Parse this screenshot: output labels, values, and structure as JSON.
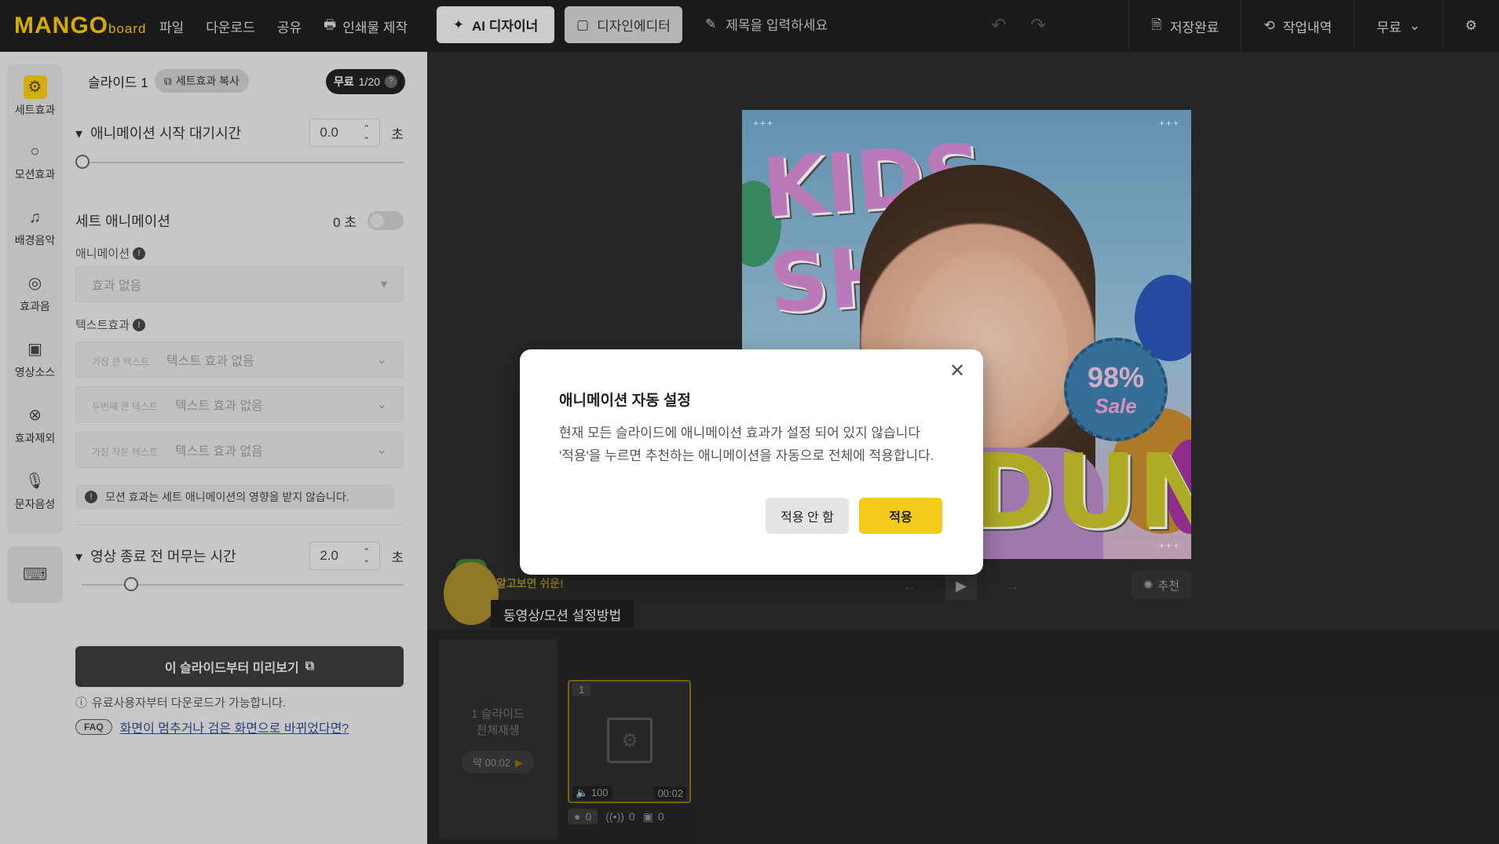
{
  "topbar": {
    "logo_main": "MANGO",
    "logo_sub": "board",
    "menu": [
      {
        "label": "파일"
      },
      {
        "label": "다운로드"
      },
      {
        "label": "공유"
      },
      {
        "label": "인쇄물 제작"
      }
    ],
    "ai_designer": "AI 디자이너",
    "design_editor": "디자인에디터",
    "title_placeholder": "제목을 입력하세요",
    "save_status": "저장완료",
    "history": "작업내역",
    "plan": "무료"
  },
  "sidebar": {
    "icons": [
      {
        "label": "세트효과",
        "icon": "set-effect-icon"
      },
      {
        "label": "모션효과",
        "icon": "motion-effect-icon"
      },
      {
        "label": "배경음악",
        "icon": "music-note-icon"
      },
      {
        "label": "효과음",
        "icon": "sound-effect-icon"
      },
      {
        "label": "영상소스",
        "icon": "video-source-icon"
      },
      {
        "label": "효과제외",
        "icon": "exclude-effect-icon"
      },
      {
        "label": "문자음성",
        "icon": "microphone-icon"
      }
    ]
  },
  "panel": {
    "slide_title": "슬라이드 1",
    "copy_set_effect": "세트효과 복사",
    "free_badge": "무료",
    "free_count": "1/20",
    "anim_start_delay_label": "애니메이션 시작 대기시간",
    "anim_start_delay_value": "0.0",
    "unit_sec": "초",
    "set_anim_label": "세트 애니메이션",
    "set_anim_value": "0 초",
    "animation_label": "애니메이션",
    "animation_select": "효과 없음",
    "text_effect_label": "텍스트효과",
    "text_rows": [
      {
        "prefix": "가장 큰 텍스트",
        "value": "텍스트 효과 없음"
      },
      {
        "prefix": "두번째 큰 텍스트",
        "value": "텍스트 효과 없음"
      },
      {
        "prefix": "가장 작은 텍스트",
        "value": "텍스트 효과 없음"
      }
    ],
    "motion_notice": "모션 효과는 세트 애니메이션의 영향을 받지 않습니다.",
    "end_hold_label": "영상 종료 전 머무는 시간",
    "end_hold_value": "2.0",
    "preview_button": "이 슬라이드부터 미리보기",
    "paid_note": "유료사용자부터 다운로드가 가능합니다.",
    "faq_badge": "FAQ",
    "faq_link": "화면이 멈추거나 검은 화면으로 바뀌었다면?"
  },
  "canvas": {
    "slide_text_top": "KIDS SHOP",
    "slide_text_bottom": "DUNT",
    "badge_num": "98%",
    "badge_word": "Sale",
    "corner_marks": "+++",
    "mascot_caption": "알고보면 쉬운!",
    "howto_label": "동영상/모션 설정방법",
    "recommend": "추천"
  },
  "timeline": {
    "playall_line1": "1 슬라이드",
    "playall_line2": "전체재생",
    "playall_duration": "약 00:02",
    "thumb_number": "1",
    "thumb_volume": "100",
    "thumb_time": "00:02",
    "stat_motion": "0",
    "stat_sound": "0",
    "stat_video": "0"
  },
  "modal": {
    "title": "애니메이션 자동 설정",
    "line1": "현재 모든 슬라이드에 애니메이션 효과가 설정 되어 있지 않습니다",
    "line2": "'적용'을 누르면 추천하는 애니메이션을 자동으로 전체에 적용합니다.",
    "cancel": "적용 안 함",
    "apply": "적용"
  }
}
